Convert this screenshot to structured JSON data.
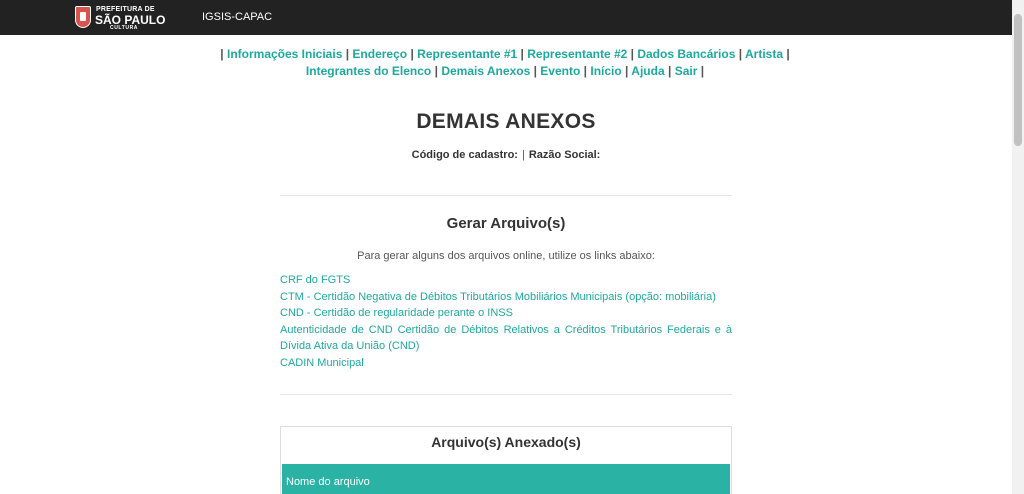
{
  "header": {
    "logo": {
      "line1": "PREFEITURA DE",
      "line2": "SÃO PAULO",
      "line3": "CULTURA"
    },
    "app_name": "IGSIS-CAPAC"
  },
  "nav": {
    "row1": [
      "Informações Iniciais",
      "Endereço",
      "Representante #1",
      "Representante #2",
      "Dados Bancários",
      "Artista"
    ],
    "row2": [
      "Integrantes do Elenco",
      "Demais Anexos",
      "Evento",
      "Início",
      "Ajuda",
      "Sair"
    ],
    "separator": "|"
  },
  "page": {
    "title": "DEMAIS ANEXOS",
    "codigo_label": "Código de cadastro:",
    "separator": "|",
    "razao_label": "Razão Social:"
  },
  "gerar": {
    "title": "Gerar Arquivo(s)",
    "intro": "Para gerar alguns dos arquivos online, utilize os links abaixo:",
    "links": [
      "CRF do FGTS",
      "CTM - Certidão Negativa de Débitos Tributários Mobiliários Municipais (opção: mobiliária)",
      "CND - Certidão de regularidade perante o INSS",
      "Autenticidade de CND  Certidão de Débitos Relativos a Créditos Tributários Federais e à Dívida Ativa da União (CND)",
      "CADIN Municipal"
    ]
  },
  "anexados": {
    "title": "Arquivo(s) Anexado(s)",
    "column_header": "Nome do arquivo"
  },
  "colors": {
    "accent": "#1fa89e",
    "table_header": "#2ab3a5",
    "topbar": "#222222"
  }
}
